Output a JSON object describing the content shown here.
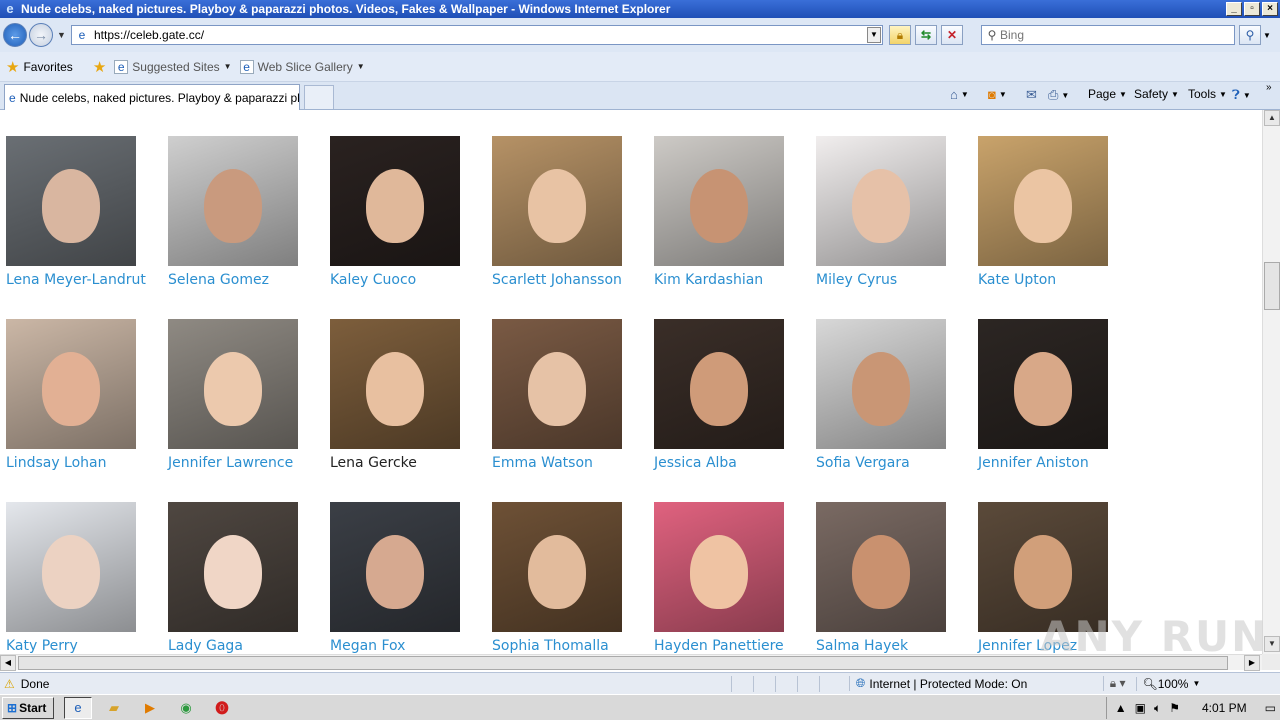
{
  "window": {
    "title": "Nude celebs, naked pictures. Playboy & paparazzi photos. Videos, Fakes & Wallpaper - Windows Internet Explorer"
  },
  "nav": {
    "url": "https://celeb.gate.cc/",
    "search_placeholder": "Bing"
  },
  "favorites_bar": {
    "favorites_label": "Favorites",
    "suggested_sites": "Suggested Sites",
    "web_slice_gallery": "Web Slice Gallery"
  },
  "tab": {
    "label": "Nude celebs, naked pictures. Playboy & paparazzi ph..."
  },
  "command_bar": {
    "page": "Page",
    "safety": "Safety",
    "tools": "Tools"
  },
  "celebs": [
    {
      "name": "Lena Meyer-Landrut",
      "bg": "#6a6f74",
      "face": "#d9b6a0"
    },
    {
      "name": "Selena Gomez",
      "bg": "#cfcfcf",
      "face": "#c99a7e"
    },
    {
      "name": "Kaley Cuoco",
      "bg": "#2a2220",
      "face": "#e0b89a"
    },
    {
      "name": "Scarlett Johansson",
      "bg": "#b69266",
      "face": "#e8c3a4"
    },
    {
      "name": "Kim Kardashian",
      "bg": "#cdcac6",
      "face": "#c79373"
    },
    {
      "name": "Miley Cyrus",
      "bg": "#f1eeee",
      "face": "#e6c1a8"
    },
    {
      "name": "Kate Upton",
      "bg": "#c9a36b",
      "face": "#ebc5a3"
    },
    {
      "name": "Lindsay Lohan",
      "bg": "#cbb7a6",
      "face": "#e2b094"
    },
    {
      "name": "Jennifer Lawrence",
      "bg": "#8f8a83",
      "face": "#ecc9ad"
    },
    {
      "name": "Lena Gercke",
      "bg": "#7d5e3c",
      "face": "#e8c0a0"
    },
    {
      "name": "Emma Watson",
      "bg": "#7a5a44",
      "face": "#e6c2a6"
    },
    {
      "name": "Jessica Alba",
      "bg": "#3a2e28",
      "face": "#cf9b79"
    },
    {
      "name": "Sofia Vergara",
      "bg": "#d8d8d8",
      "face": "#c99675"
    },
    {
      "name": "Jennifer Aniston",
      "bg": "#2c2623",
      "face": "#d8a888"
    },
    {
      "name": "Katy Perry",
      "bg": "#e4e7ec",
      "face": "#ecd2c2"
    },
    {
      "name": "Lady Gaga",
      "bg": "#4f4741",
      "face": "#f0d6c6"
    },
    {
      "name": "Megan Fox",
      "bg": "#3b3f46",
      "face": "#d6a990"
    },
    {
      "name": "Sophia Thomalla",
      "bg": "#6e5136",
      "face": "#e2bb9c"
    },
    {
      "name": "Hayden Panettiere",
      "bg": "#e0627f",
      "face": "#efc3a3"
    },
    {
      "name": "Salma Hayek",
      "bg": "#7a6a63",
      "face": "#c9916f"
    },
    {
      "name": "Jennifer Lopez",
      "bg": "#5b4a3a",
      "face": "#d19f7a"
    }
  ],
  "status": {
    "text": "Done",
    "zone": "Internet | Protected Mode: On",
    "zoom": "100%"
  },
  "taskbar": {
    "start": "Start",
    "clock": "4:01 PM"
  },
  "watermark": "ANY RUN",
  "icons": {
    "back": "back-arrow-icon",
    "forward": "forward-arrow-icon",
    "refresh": "refresh-icon",
    "stop": "stop-icon",
    "lock": "lock-icon",
    "search": "search-icon",
    "home": "home-icon",
    "feeds": "rss-icon",
    "mail": "mail-icon",
    "print": "print-icon",
    "help": "help-icon"
  }
}
